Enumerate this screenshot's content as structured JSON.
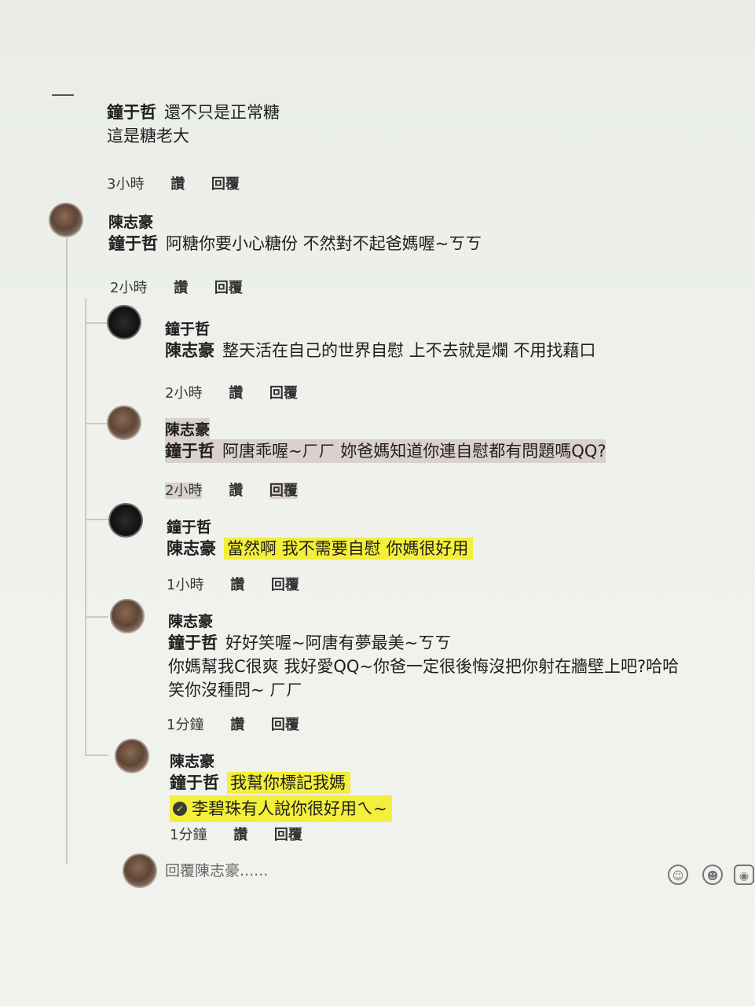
{
  "comments": [
    {
      "author": "鐘于哲",
      "line1": "還不只是正常糖",
      "line2": "這是糖老大",
      "time": "3小時",
      "like": "讚",
      "reply": "回覆"
    },
    {
      "author": "陳志豪",
      "mention": "鐘于哲",
      "text": "阿糖你要小心糖份 不然對不起爸媽喔~ㄎㄎ",
      "time": "2小時",
      "like": "讚",
      "reply": "回覆"
    },
    {
      "author": "鐘于哲",
      "mention": "陳志豪",
      "text": "整天活在自己的世界自慰 上不去就是爛 不用找藉口",
      "time": "2小時",
      "like": "讚",
      "reply": "回覆"
    },
    {
      "author": "陳志豪",
      "mention": "鐘于哲",
      "text": "阿唐乖喔~ㄏㄏ 妳爸媽知道你連自慰都有問題嗎QQ?",
      "time": "2小時",
      "like": "讚",
      "reply": "回覆"
    },
    {
      "author": "鐘于哲",
      "mention": "陳志豪",
      "text": "當然啊 我不需要自慰 你媽很好用",
      "time": "1小時",
      "like": "讚",
      "reply": "回覆"
    },
    {
      "author": "陳志豪",
      "mention": "鐘于哲",
      "line1": "好好笑喔~阿唐有夢最美~ㄎㄎ",
      "line2": "你媽幫我C很爽 我好愛QQ~你爸一定很後悔沒把你射在牆壁上吧?哈哈",
      "line3": "笑你沒種問~ ㄏㄏ",
      "time": "1分鐘",
      "like": "讚",
      "reply": "回覆"
    },
    {
      "author": "陳志豪",
      "mention": "鐘于哲",
      "line1": "我幫你標記我媽",
      "tag_name": "李碧珠",
      "tag_text": "有人說你很好用ㄟ~",
      "time": "1分鐘",
      "like": "讚",
      "reply": "回覆"
    }
  ],
  "reply_placeholder": "回覆陳志豪......",
  "colors": {
    "highlight": "#f3ef3a",
    "background": "#eef1ec"
  },
  "icons": [
    "avatar",
    "emoji-icon",
    "smile-icon",
    "camera-icon",
    "check-circle-icon"
  ]
}
